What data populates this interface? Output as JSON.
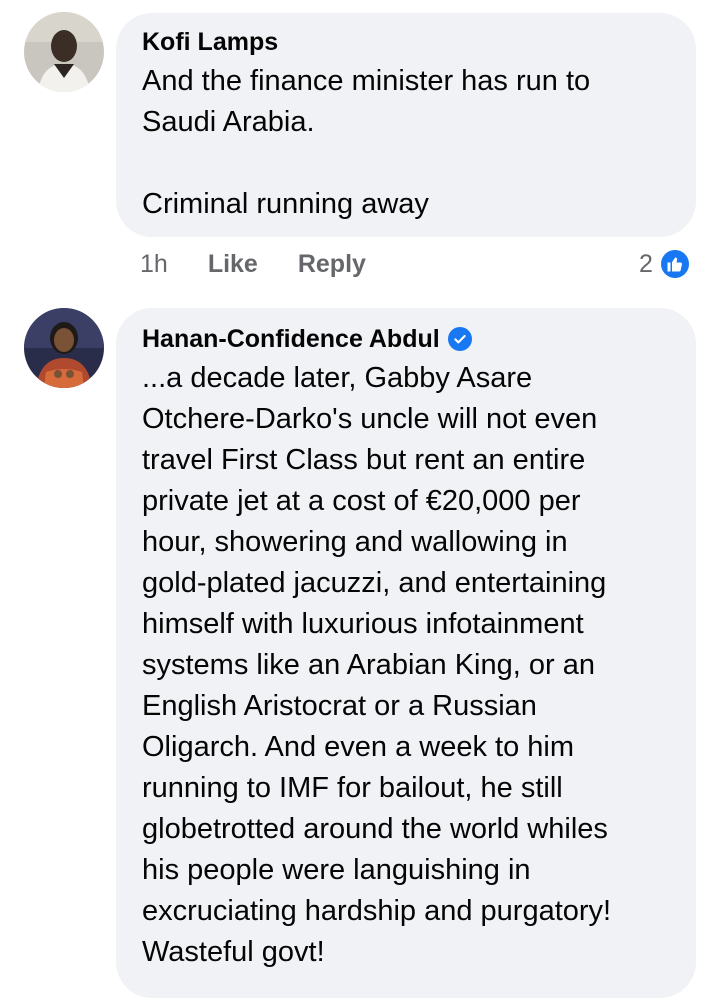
{
  "comments": [
    {
      "author": "Kofi Lamps",
      "text": "And the finance minister has run to\nSaudi Arabia.\n\nCriminal running away",
      "time": "1h",
      "like_label": "Like",
      "reply_label": "Reply",
      "reaction_count": "2",
      "avatar_icon": "avatar-photo"
    },
    {
      "author": "Hanan-Confidence Abdul",
      "verified": true,
      "text": "...a decade later, Gabby Asare\nOtchere-Darko's uncle will not even\ntravel First Class but rent an entire\nprivate jet at a cost of €20,000 per\nhour, showering and wallowing in\ngold-plated jacuzzi, and entertaining\nhimself with luxurious infotainment\nsystems like an Arabian King, or an\nEnglish Aristocrat or a Russian\nOligarch. And even a week to him\nrunning to IMF for bailout, he still\nglobetrotted around the world whiles\nhis people were languishing in\nexcruciating hardship and purgatory!\nWasteful govt!",
      "avatar_icon": "avatar-photo"
    }
  ],
  "colors": {
    "bubble": "#f0f2f5",
    "meta": "#65676b",
    "accent": "#1877f2"
  }
}
